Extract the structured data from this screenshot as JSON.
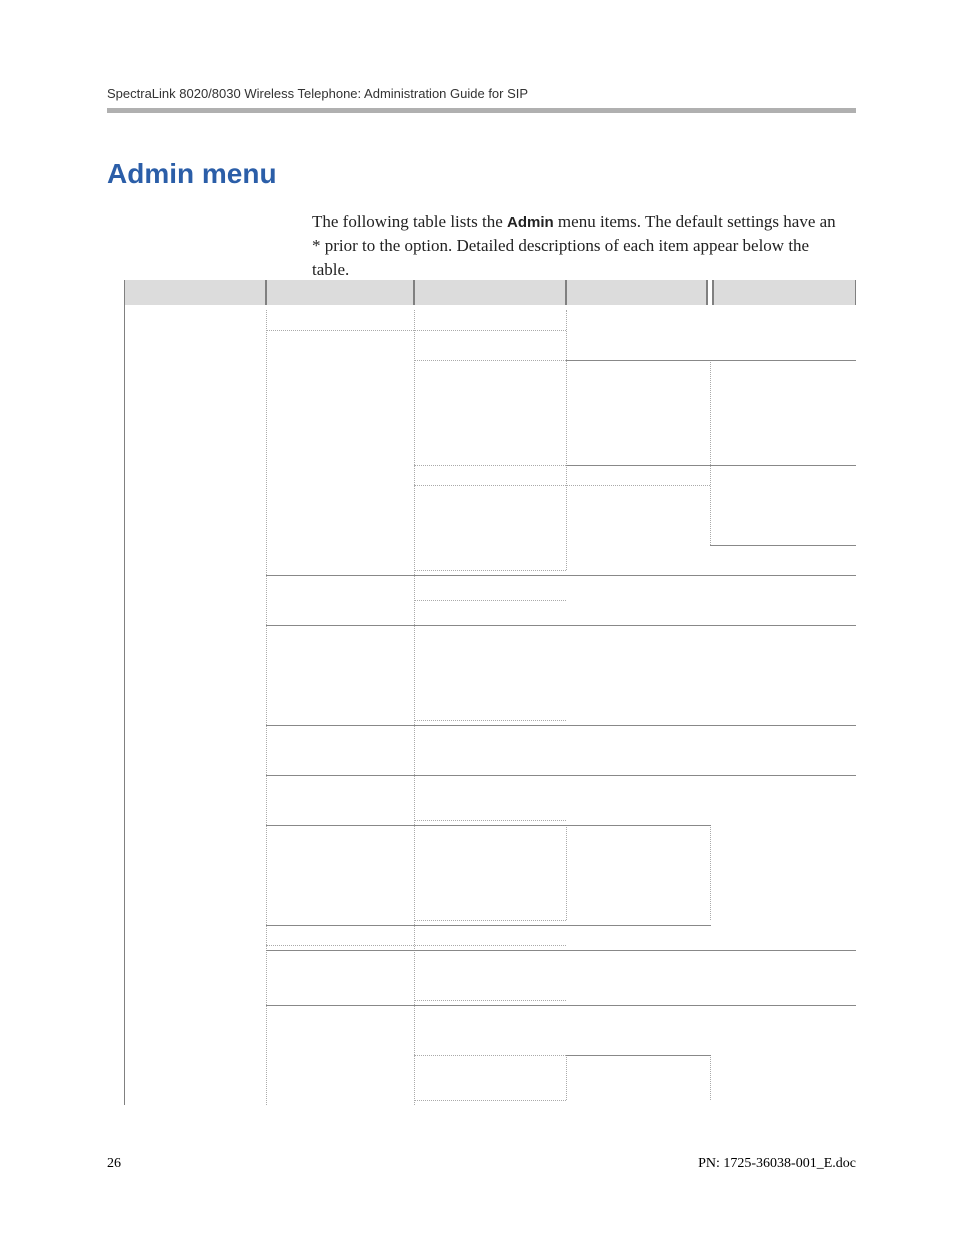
{
  "header": "SpectraLink 8020/8030 Wireless Telephone: Administration Guide for SIP",
  "section_title": "Admin menu",
  "intro_pre": "The following table lists the ",
  "intro_bold": "Admin",
  "intro_post": " menu items. The default settings have an * prior to the option. Detailed descriptions of each item appear below the table.",
  "footer": {
    "page": "26",
    "pn": "PN: 1725-36038-001_E.doc"
  }
}
